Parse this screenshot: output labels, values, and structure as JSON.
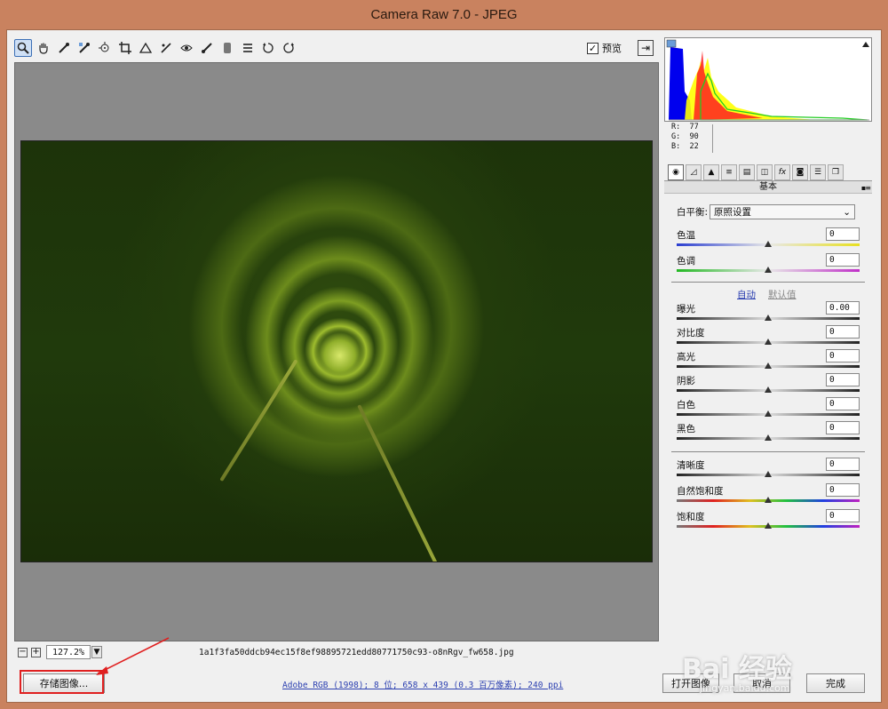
{
  "window": {
    "title": "Camera Raw 7.0 -  JPEG"
  },
  "toolbar": {
    "tools": [
      "zoom-icon",
      "hand-icon",
      "white-balance-icon",
      "color-sampler-icon",
      "target-adjust-icon",
      "crop-icon",
      "straighten-icon",
      "spot-removal-icon",
      "red-eye-icon",
      "adjustment-brush-icon",
      "graduated-filter-icon",
      "preferences-icon",
      "rotate-ccw-icon",
      "rotate-cw-icon"
    ],
    "preview_label": "预览",
    "preview_checked": true
  },
  "status": {
    "zoom_value": "127.2%",
    "filename": "1a1f3fa50ddcb94ec15f8ef98895721edd80771750c93-o8nRgv_fw658.jpg"
  },
  "histogram": {
    "r_label": "R:",
    "r_value": "77",
    "g_label": "G:",
    "g_value": "90",
    "b_label": "B:",
    "b_value": "22"
  },
  "panel": {
    "title": "基本",
    "tabs": [
      "basic-icon",
      "tone-curve-icon",
      "detail-icon",
      "hsl-icon",
      "split-toning-icon",
      "lens-icon",
      "fx-icon",
      "camera-calibration-icon",
      "presets-icon",
      "snapshots-icon"
    ],
    "white_balance_label": "白平衡:",
    "white_balance_value": "原照设置",
    "auto_label": "自动",
    "default_label": "默认值",
    "adjustments": [
      {
        "label": "色温",
        "value": "0",
        "level": 0.5,
        "track": "temp"
      },
      {
        "label": "色调",
        "value": "0",
        "level": 0.5,
        "track": "tint"
      },
      {
        "label": "曝光",
        "value": "0.00",
        "level": 0.5,
        "track": "gray"
      },
      {
        "label": "对比度",
        "value": "0",
        "level": 0.5,
        "track": "gray"
      },
      {
        "label": "高光",
        "value": "0",
        "level": 0.5,
        "track": "gray"
      },
      {
        "label": "阴影",
        "value": "0",
        "level": 0.5,
        "track": "gray"
      },
      {
        "label": "白色",
        "value": "0",
        "level": 0.5,
        "track": "gray"
      },
      {
        "label": "黑色",
        "value": "0",
        "level": 0.5,
        "track": "gray"
      },
      {
        "label": "清晰度",
        "value": "0",
        "level": 0.5,
        "track": "gray"
      },
      {
        "label": "自然饱和度",
        "value": "0",
        "level": 0.5,
        "track": "rainbow"
      },
      {
        "label": "饱和度",
        "value": "0",
        "level": 0.5,
        "track": "rainbow"
      }
    ]
  },
  "bottom": {
    "save_label": "存储图像...",
    "workflow_text": "Adobe RGB (1998); 8 位; 658 x 439 (0.3 百万像素); 240 ppi",
    "open_label": "打开图像",
    "cancel_label": "取消",
    "done_label": "完成"
  },
  "watermark": {
    "text": "Bai  经验",
    "subtext": "jingyan.baidu.com"
  },
  "colors": {
    "annotation": "#e02020",
    "link": "#2b3fb0",
    "frame": "#c9825f"
  }
}
